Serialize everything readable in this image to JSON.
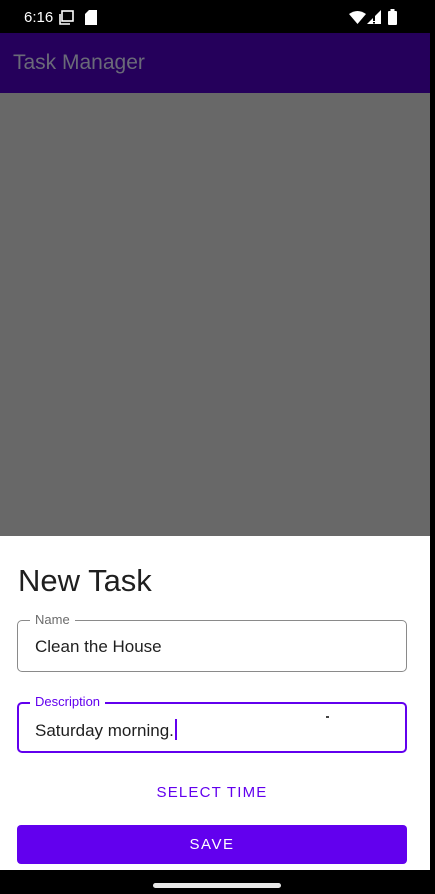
{
  "status_bar": {
    "time": "6:16",
    "icons": [
      "media-icon",
      "sd-card-icon",
      "wifi-icon",
      "signal-icon",
      "battery-icon"
    ]
  },
  "app_bar": {
    "title": "Task Manager"
  },
  "dialog": {
    "title": "New Task",
    "name_field": {
      "label": "Name",
      "value": "Clean the House"
    },
    "description_field": {
      "label": "Description",
      "value": "Saturday morning."
    },
    "select_time_label": "SELECT TIME",
    "save_label": "SAVE"
  },
  "colors": {
    "accent": "#6200ee",
    "app_bar": "#25005b",
    "scrim": "#686868"
  }
}
